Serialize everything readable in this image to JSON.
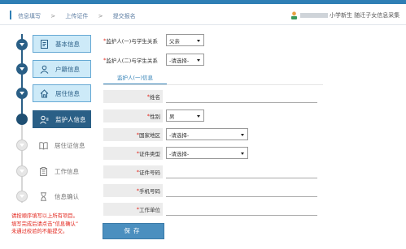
{
  "breadcrumb": {
    "items": [
      "信息填写",
      "上传证件",
      "提交报名"
    ],
    "separator": ">"
  },
  "user": {
    "text": "小学新生 随迁子女信息采集"
  },
  "steps": [
    {
      "label": "基本信息",
      "icon": "document-icon",
      "state": "done"
    },
    {
      "label": "户籍信息",
      "icon": "person-icon",
      "state": "done"
    },
    {
      "label": "居住信息",
      "icon": "house-icon",
      "state": "done"
    },
    {
      "label": "监护人信息",
      "icon": "guardian-icon",
      "state": "current"
    },
    {
      "label": "居住证信息",
      "icon": "book-icon",
      "state": "todo"
    },
    {
      "label": "工作信息",
      "icon": "clipboard-icon",
      "state": "todo"
    },
    {
      "label": "信息确认",
      "icon": "hourglass-icon",
      "state": "todo"
    }
  ],
  "notes": [
    "请按顺序填写以上所有项目。",
    "填写完成后请点击“信息确认”",
    "未通过校验的不能提交。"
  ],
  "form": {
    "relation1": {
      "label": "监护人(一)与学生关系",
      "value": "父亲"
    },
    "relation2": {
      "label": "监护人(二)与学生关系",
      "value": "-请选择-"
    },
    "tab": "监护人(一)信息",
    "name": {
      "label": "姓名"
    },
    "gender": {
      "label": "性别",
      "value": "男"
    },
    "country": {
      "label": "国家地区",
      "value": "-请选择-"
    },
    "id_type": {
      "label": "证件类型",
      "value": "-请选择-"
    },
    "id_number": {
      "label": "证件号码"
    },
    "phone": {
      "label": "手机号码"
    },
    "employer": {
      "label": "工作单位"
    },
    "save_label": "保存"
  },
  "colors": {
    "accent": "#2f7fb5",
    "required": "#e2231a",
    "current_step": "#2a5f86"
  }
}
